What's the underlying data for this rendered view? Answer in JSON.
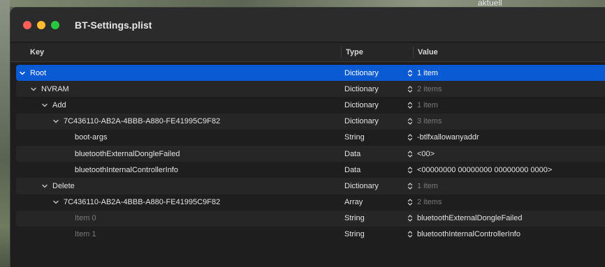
{
  "desktop": {
    "label": "aktuell"
  },
  "window": {
    "title": "BT-Settings.plist"
  },
  "columns": {
    "key": "Key",
    "type": "Type",
    "value": "Value"
  },
  "rows": [
    {
      "key": "Root",
      "type": "Dictionary",
      "value": "1 item",
      "indent": 0,
      "disclosure": "expanded",
      "value_dim": false,
      "key_dim": false,
      "selected": true
    },
    {
      "key": "NVRAM",
      "type": "Dictionary",
      "value": "2 items",
      "indent": 1,
      "disclosure": "expanded",
      "value_dim": true,
      "key_dim": false,
      "selected": false
    },
    {
      "key": "Add",
      "type": "Dictionary",
      "value": "1 item",
      "indent": 2,
      "disclosure": "expanded",
      "value_dim": true,
      "key_dim": false,
      "selected": false
    },
    {
      "key": "7C436110-AB2A-4BBB-A880-FE41995C9F82",
      "type": "Dictionary",
      "value": "3 items",
      "indent": 3,
      "disclosure": "expanded",
      "value_dim": true,
      "key_dim": false,
      "selected": false
    },
    {
      "key": "boot-args",
      "type": "String",
      "value": "-btlfxallowanyaddr",
      "indent": 4,
      "disclosure": "none",
      "value_dim": false,
      "key_dim": false,
      "selected": false
    },
    {
      "key": "bluetoothExternalDongleFailed",
      "type": "Data",
      "value": "<00>",
      "indent": 4,
      "disclosure": "none",
      "value_dim": false,
      "key_dim": false,
      "selected": false
    },
    {
      "key": "bluetoothInternalControllerInfo",
      "type": "Data",
      "value": "<00000000 00000000 00000000 0000>",
      "indent": 4,
      "disclosure": "none",
      "value_dim": false,
      "key_dim": false,
      "selected": false
    },
    {
      "key": "Delete",
      "type": "Dictionary",
      "value": "1 item",
      "indent": 2,
      "disclosure": "expanded",
      "value_dim": true,
      "key_dim": false,
      "selected": false
    },
    {
      "key": "7C436110-AB2A-4BBB-A880-FE41995C9F82",
      "type": "Array",
      "value": "2 items",
      "indent": 3,
      "disclosure": "expanded",
      "value_dim": true,
      "key_dim": false,
      "selected": false
    },
    {
      "key": "Item 0",
      "type": "String",
      "value": "bluetoothExternalDongleFailed",
      "indent": 4,
      "disclosure": "none",
      "value_dim": false,
      "key_dim": true,
      "selected": false
    },
    {
      "key": "Item 1",
      "type": "String",
      "value": "bluetoothInternalControllerInfo",
      "indent": 4,
      "disclosure": "none",
      "value_dim": false,
      "key_dim": true,
      "selected": false
    }
  ]
}
